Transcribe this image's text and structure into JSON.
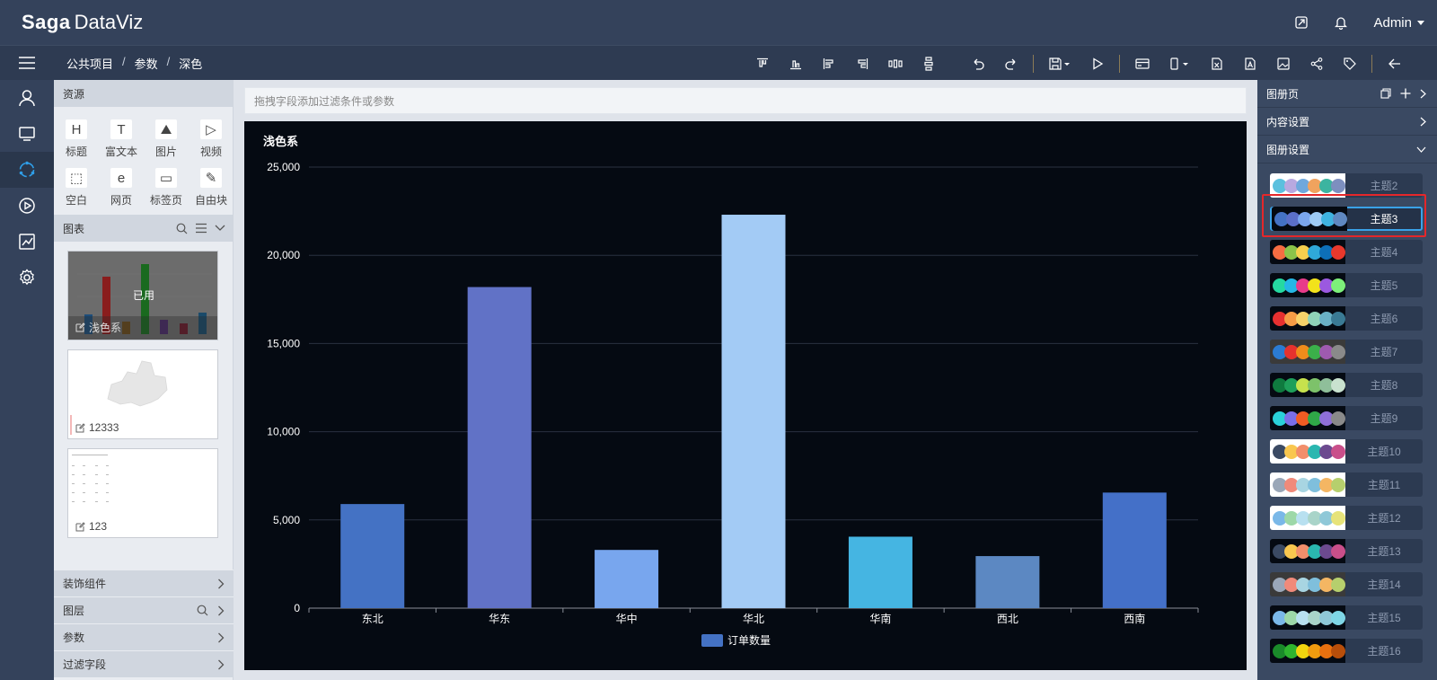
{
  "app": {
    "logo_saga": "Saga",
    "logo_dataviz": "DataViz",
    "user": "Admin"
  },
  "breadcrumb": [
    "公共项目",
    "参数",
    "深色"
  ],
  "left_panel": {
    "resources_title": "资源",
    "resources": [
      {
        "glyph": "H",
        "label": "标题",
        "icon": "heading-icon"
      },
      {
        "glyph": "T",
        "label": "富文本",
        "icon": "rich-text-icon"
      },
      {
        "glyph": "⛰",
        "label": "图片",
        "icon": "image-icon"
      },
      {
        "glyph": "▷",
        "label": "视频",
        "icon": "video-icon"
      },
      {
        "glyph": "⬚",
        "label": "空白",
        "icon": "blank-icon"
      },
      {
        "glyph": "e",
        "label": "网页",
        "icon": "webpage-icon"
      },
      {
        "glyph": "▭",
        "label": "标签页",
        "icon": "tab-page-icon"
      },
      {
        "glyph": "✎",
        "label": "自由块",
        "icon": "free-block-icon"
      }
    ],
    "charts_title": "图表",
    "thumbnails": [
      {
        "name": "浅色系",
        "used": "已用"
      },
      {
        "name": "12333"
      },
      {
        "name": "123"
      }
    ],
    "sections": [
      "装饰组件",
      "图层",
      "参数",
      "过滤字段"
    ]
  },
  "filter_placeholder": "拖拽字段添加过滤条件或参数",
  "right_panel": {
    "album_page": "图册页",
    "content_settings": "内容设置",
    "album_settings": "图册设置",
    "themes": [
      {
        "label": "主题2",
        "bg": "#ffffff",
        "colors": [
          "#5bc0de",
          "#b8a9e0",
          "#6fa8dc",
          "#f0a35e",
          "#3cb4a0",
          "#7d8fbf"
        ]
      },
      {
        "label": "主题3",
        "bg": "#050a12",
        "colors": [
          "#4472c4",
          "#5b6fc8",
          "#7aa6ee",
          "#9ecbf5",
          "#3fb3e0",
          "#5f88c0"
        ],
        "selected": true
      },
      {
        "label": "主题4",
        "bg": "#050a12",
        "colors": [
          "#f56c42",
          "#8bc34a",
          "#f6cf4e",
          "#2fa8d9",
          "#0d6fb8",
          "#e8382c"
        ]
      },
      {
        "label": "主题5",
        "bg": "#050a12",
        "colors": [
          "#25d9a0",
          "#25b7e6",
          "#e83b8a",
          "#f2e21b",
          "#9b59e0",
          "#7df07a"
        ]
      },
      {
        "label": "主题6",
        "bg": "#050a12",
        "colors": [
          "#e63030",
          "#f59c46",
          "#f7d36a",
          "#8fd3b8",
          "#6ab1c6",
          "#3a7a94"
        ]
      },
      {
        "label": "主题7",
        "bg": "#3a3a3a",
        "colors": [
          "#2b7bd1",
          "#e6322e",
          "#f08c1b",
          "#3bb04a",
          "#9f5ab0",
          "#8a8a8a"
        ]
      },
      {
        "label": "主题8",
        "bg": "#050a12",
        "colors": [
          "#0f7a3f",
          "#1e9f5a",
          "#c6e24d",
          "#7dc26a",
          "#8fbf9a",
          "#c9e2cf"
        ]
      },
      {
        "label": "主题9",
        "bg": "#050a12",
        "colors": [
          "#2ad0d8",
          "#7a6ee8",
          "#f05c23",
          "#2fa848",
          "#8e6fd8",
          "#8a8a8a"
        ]
      },
      {
        "label": "主题10",
        "bg": "#ffffff",
        "colors": [
          "#3b4a63",
          "#f9c74f",
          "#f28e6b",
          "#2ab7b0",
          "#6c4a8f",
          "#c94f8a"
        ]
      },
      {
        "label": "主题11",
        "bg": "#ffffff",
        "colors": [
          "#9aa7b8",
          "#f08a7a",
          "#a8d5e2",
          "#7fbfdc",
          "#f4b663",
          "#b6cf6d"
        ]
      },
      {
        "label": "主题12",
        "bg": "#ffffff",
        "colors": [
          "#7ab8e8",
          "#9dd8a8",
          "#b8e0f0",
          "#a9d4c9",
          "#8fc8d8",
          "#e7e37a"
        ]
      },
      {
        "label": "主题13",
        "bg": "#050a12",
        "colors": [
          "#3b4a63",
          "#f9c74f",
          "#f28e6b",
          "#2ab7b0",
          "#6c4a8f",
          "#c94f8a"
        ]
      },
      {
        "label": "主题14",
        "bg": "#3a3a3a",
        "colors": [
          "#9aa7b8",
          "#f08a7a",
          "#a8d5e2",
          "#7fbfdc",
          "#f4b663",
          "#b6cf6d"
        ]
      },
      {
        "label": "主题15",
        "bg": "#050a12",
        "colors": [
          "#7ab8e8",
          "#9dd8a8",
          "#b8e0f0",
          "#a9d4c9",
          "#8fc8d8",
          "#7fd6e6"
        ]
      },
      {
        "label": "主题16",
        "bg": "#050a12",
        "colors": [
          "#1a8a2a",
          "#2fb52f",
          "#f1d40f",
          "#f09b0f",
          "#e8700f",
          "#b84e0a"
        ]
      }
    ]
  },
  "chart_data": {
    "type": "bar",
    "title": "浅色系",
    "categories": [
      "东北",
      "华东",
      "华中",
      "华北",
      "华南",
      "西北",
      "西南"
    ],
    "series": [
      {
        "name": "订单数量",
        "values": [
          5900,
          18200,
          3300,
          22300,
          4050,
          2950,
          6550
        ]
      }
    ],
    "bar_colors": [
      "#4472c4",
      "#6172c6",
      "#78a6ee",
      "#a3cbf5",
      "#45b5e2",
      "#5c88c2",
      "#4470c8"
    ],
    "legend_color": "#4472c4",
    "ylim": [
      0,
      25000
    ],
    "yticks": [
      "0",
      "5,000",
      "10,000",
      "15,000",
      "20,000",
      "25,000"
    ],
    "grid": true,
    "legend_position": "bottom-center"
  }
}
